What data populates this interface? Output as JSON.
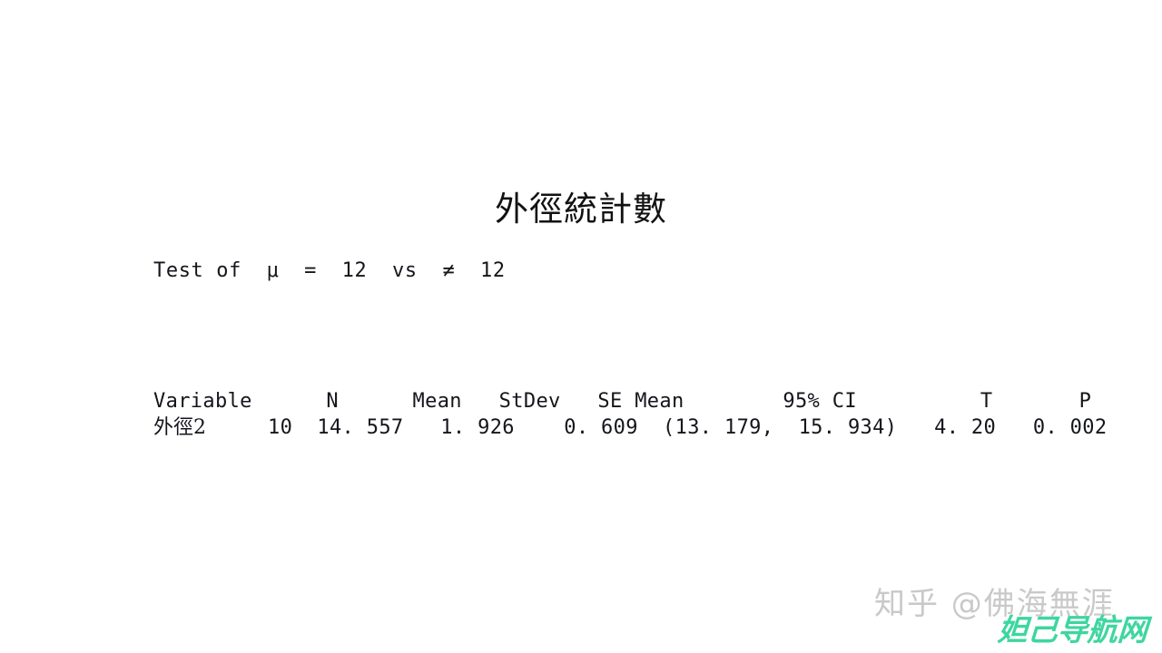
{
  "page": {
    "background_color": "#ffffff",
    "text_color": "#15161c"
  },
  "title": "外徑統計數",
  "test_statement": {
    "full_text": "Test of  μ  =  12  vs  ≠  12",
    "label": "Test of",
    "parameter": "μ",
    "null_operator": "=",
    "null_value": "12",
    "vs": "vs",
    "alt_operator": "≠",
    "alt_value": "12"
  },
  "stats_table": {
    "headers": [
      "Variable",
      "N",
      "Mean",
      "StDev",
      "SE Mean",
      "95% CI",
      "T",
      "P"
    ],
    "header_line": "Variable      N      Mean   StDev   SE Mean        95% CI          T       P",
    "rows": [
      {
        "variable": "外徑2",
        "n": "10",
        "mean": "14.557",
        "stdev": "1.926",
        "se_mean": "0.609",
        "ci": "(13.179, 15.934)",
        "t": "4.20",
        "p": "0.002",
        "data_line_tail": "     10  14. 557   1. 926    0. 609  (13. 179,  15. 934)   4. 20   0. 002"
      }
    ]
  },
  "watermarks": {
    "zhihu": {
      "text": "知乎 @佛海無涯",
      "color": "#c9c9c9"
    },
    "nav": {
      "text": "妲己导航网",
      "color": "#3ed6a0"
    }
  }
}
